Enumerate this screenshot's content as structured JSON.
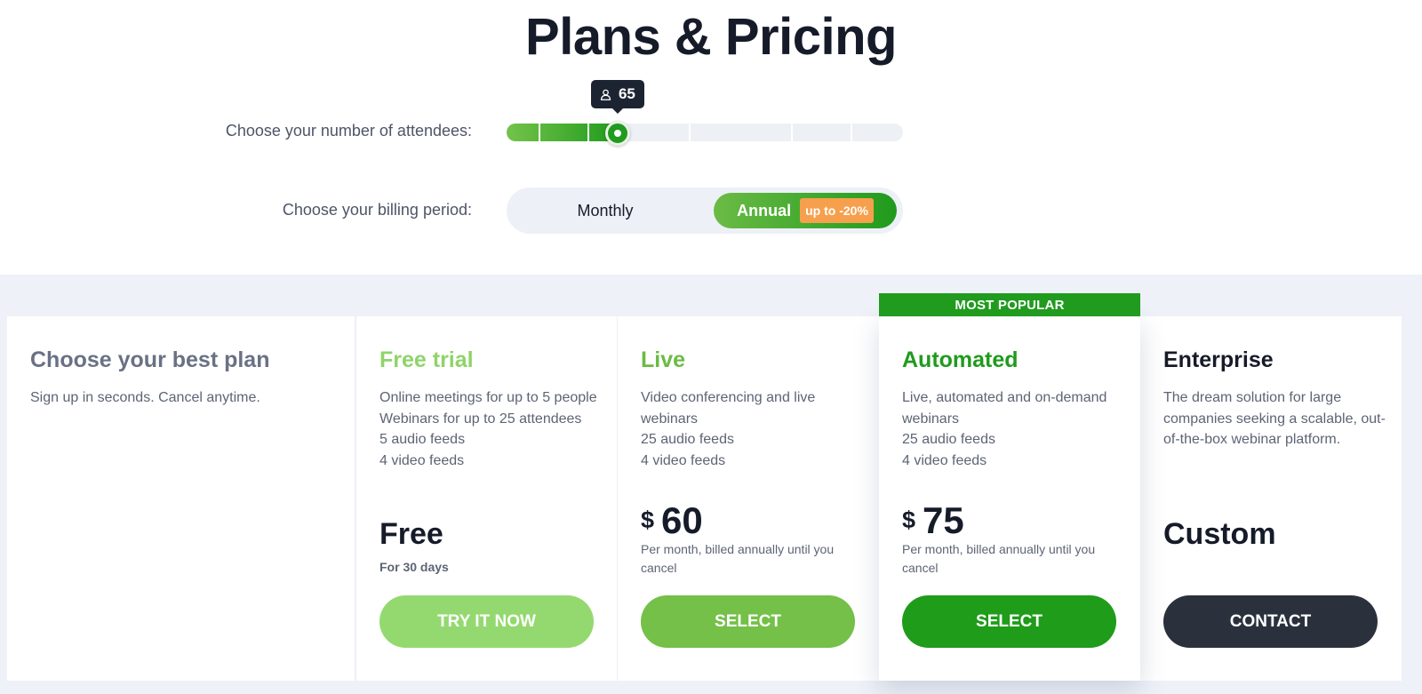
{
  "header": {
    "title": "Plans & Pricing"
  },
  "attendees": {
    "label": "Choose your number of attendees:",
    "value": "65",
    "value_number": 65,
    "fill_fraction": 0.28,
    "tick_fractions": [
      0.08,
      0.205,
      0.46,
      0.717,
      0.868
    ],
    "icon": "user-icon"
  },
  "billing": {
    "label": "Choose your billing period:",
    "monthly_label": "Monthly",
    "annual_label": "Annual",
    "discount_badge": "up to -20%",
    "selected": "Annual"
  },
  "intro": {
    "title": "Choose your best plan",
    "subtitle": "Sign up in seconds. Cancel anytime."
  },
  "plans": {
    "free": {
      "name": "Free trial",
      "features": [
        "Online meetings for up to 5 people",
        "Webinars for up to 25 attendees",
        "5 audio feeds",
        "4 video feeds"
      ],
      "price": "Free",
      "price_sub": "For 30 days",
      "cta": "TRY IT NOW"
    },
    "live": {
      "name": "Live",
      "features": [
        "Video conferencing and live webinars",
        "25 audio feeds",
        "4 video feeds"
      ],
      "currency": "$",
      "price": "60",
      "price_note": "Per month, billed annually until you cancel",
      "cta": "SELECT"
    },
    "automated": {
      "banner": "MOST POPULAR",
      "name": "Automated",
      "features": [
        "Live, automated and on-demand webinars",
        "25 audio feeds",
        "4 video feeds"
      ],
      "currency": "$",
      "price": "75",
      "price_note": "Per month, billed annually until you cancel",
      "cta": "SELECT"
    },
    "enterprise": {
      "name": "Enterprise",
      "description": "The dream solution for large companies seeking a scalable, out-of-the-box webinar platform.",
      "price": "Custom",
      "cta": "CONTACT"
    }
  },
  "colors": {
    "brand_green": "#209b1e",
    "light_green": "#94d96f",
    "mid_green": "#74c048",
    "dark": "#2b313c",
    "badge_orange": "#f6a04d"
  }
}
